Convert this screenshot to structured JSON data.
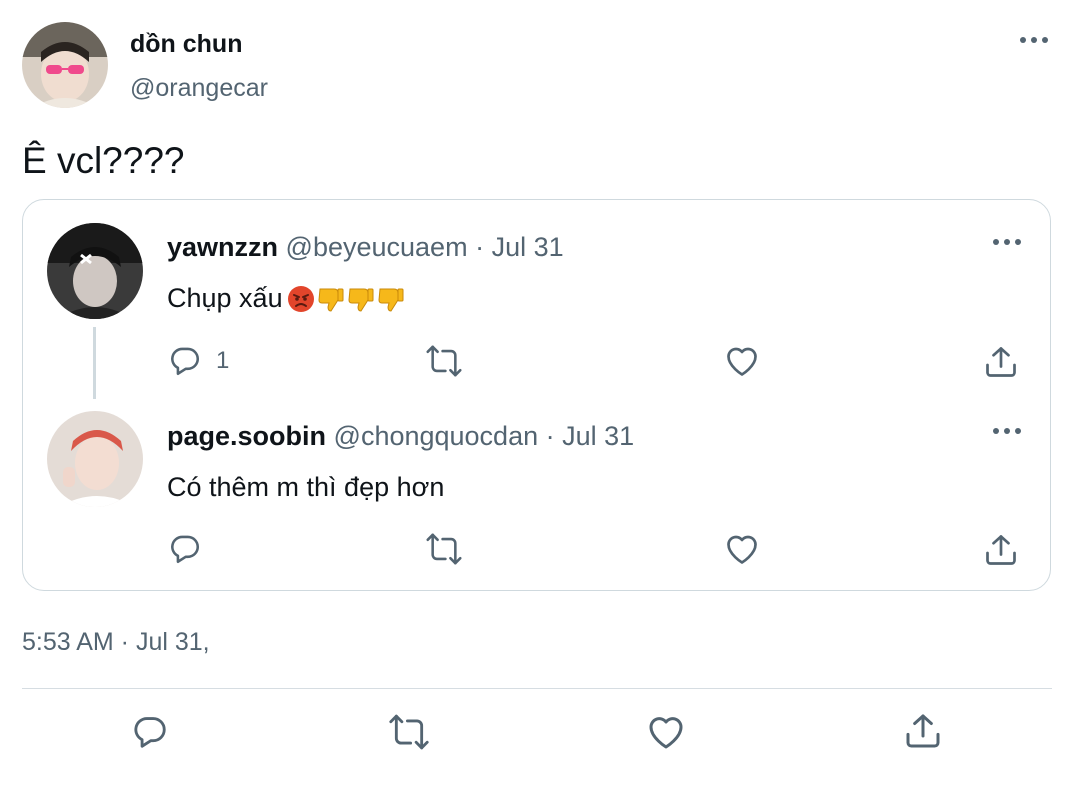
{
  "tweet": {
    "author_name": "dồn chun",
    "author_handle": "@orangecar",
    "text": "Ê vcl????",
    "timestamp": "5:53 AM · Jul 31,"
  },
  "quoted_thread": [
    {
      "name": "yawnzzn",
      "handle": "@beyeucuaem",
      "separator": " · ",
      "date": "Jul 31",
      "text": "Chụp xấu ",
      "emojis": [
        "angry-face",
        "thumbs-down",
        "thumbs-down",
        "thumbs-down"
      ],
      "reply_count": "1"
    },
    {
      "name": "page.soobin",
      "handle": "@chongquocdan",
      "separator": " · ",
      "date": "Jul 31",
      "text": "Có thêm m thì đẹp hơn",
      "reply_count": ""
    }
  ],
  "icons": {
    "reply": "reply-icon",
    "retweet": "retweet-icon",
    "like": "like-icon",
    "share": "share-icon",
    "more": "more-icon"
  },
  "colors": {
    "text": "#0f1419",
    "secondary": "#536471",
    "border": "#cfd9de",
    "emoji_yellow": "#f6b81a",
    "emoji_red": "#e2452b"
  }
}
